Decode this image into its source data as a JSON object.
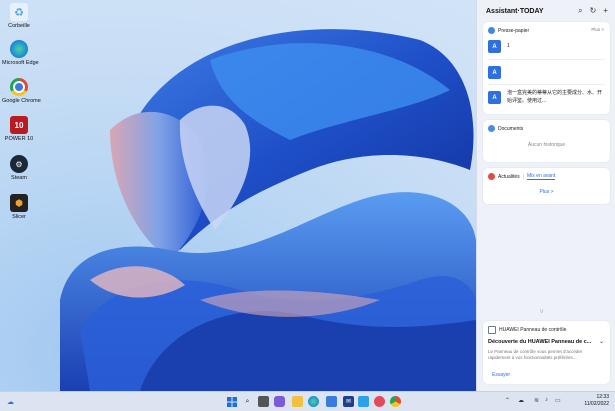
{
  "desktop": {
    "icons": [
      {
        "label": "Corbeille",
        "icon": "recycle-bin-icon",
        "color": "#4aa3df"
      },
      {
        "label": "Microsoft Edge",
        "icon": "edge-icon",
        "color": "#1c8fd8"
      },
      {
        "label": "Google Chrome",
        "icon": "chrome-icon",
        "color": "#dd4b39"
      },
      {
        "label": "POWER 10",
        "icon": "power10-icon",
        "color": "#b81c22"
      },
      {
        "label": "Steam",
        "icon": "steam-icon",
        "color": "#1b2838"
      },
      {
        "label": "Slicer",
        "icon": "slicer-icon",
        "color": "#222222"
      }
    ]
  },
  "panel": {
    "title": "Assistant·TODAY",
    "clipboard": {
      "title": "Presse-papier",
      "more": "Plus >",
      "items": [
        {
          "text": "1"
        },
        {
          "text": ""
        },
        {
          "text": "泡一盒完美的蒂蒂从它的主要成分、水、开始评鉴。使用过..."
        }
      ]
    },
    "documents": {
      "title": "Documents",
      "empty": "Aucun historique"
    },
    "news": {
      "tab1": "Actualités",
      "tab2": "Mis en avant",
      "more": "Plus >"
    },
    "huawei": {
      "header": "HUAWEI Panneau de contrôle",
      "title": "Découverte du HUAWEI Panneau de c...",
      "desc": "Le Panneau de contrôle vous permet d'accéder rapidement à vos fonctionnalités préférées....",
      "action": "Essayer"
    }
  },
  "taskbar": {
    "time": "12:33",
    "date": "11/02/2022",
    "apps": [
      "windows-start-icon",
      "search-icon",
      "task-view-icon",
      "chat-icon",
      "file-explorer-icon",
      "edge-icon",
      "store-icon",
      "mail-icon",
      "photos-icon",
      "huawei-assistant-icon",
      "chrome-icon"
    ]
  },
  "colors": {
    "accent": "#2f6fe0",
    "panel_bg": "#eef1f7"
  }
}
